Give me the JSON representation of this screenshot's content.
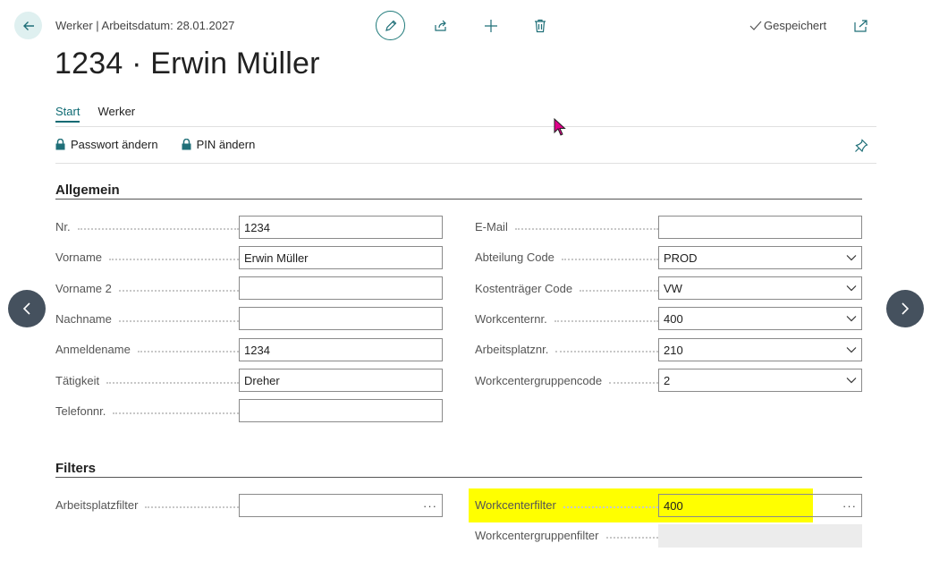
{
  "header": {
    "context": "Werker | Arbeitsdatum: 28.01.2027",
    "title": "1234 · Erwin Müller",
    "saved_label": "Gespeichert"
  },
  "tabs": [
    {
      "label": "Start",
      "active": true
    },
    {
      "label": "Werker",
      "active": false
    }
  ],
  "actions": [
    {
      "label": "Passwort ändern",
      "icon": "lock-icon"
    },
    {
      "label": "PIN ändern",
      "icon": "lock-icon"
    }
  ],
  "sections": {
    "general": {
      "title": "Allgemein",
      "left": [
        {
          "label": "Nr.",
          "value": "1234"
        },
        {
          "label": "Vorname",
          "value": "Erwin Müller"
        },
        {
          "label": "Vorname 2",
          "value": ""
        },
        {
          "label": "Nachname",
          "value": ""
        },
        {
          "label": "Anmeldename",
          "value": "1234"
        },
        {
          "label": "Tätigkeit",
          "value": "Dreher"
        },
        {
          "label": "Telefonnr.",
          "value": ""
        }
      ],
      "right": [
        {
          "label": "E-Mail",
          "value": ""
        },
        {
          "label": "Abteilung Code",
          "value": "PROD"
        },
        {
          "label": "Kostenträger Code",
          "value": "VW"
        },
        {
          "label": "Workcenternr.",
          "value": "400"
        },
        {
          "label": "Arbeitsplatznr.",
          "value": "210"
        },
        {
          "label": "Workcentergruppencode",
          "value": "2"
        }
      ]
    },
    "filters": {
      "title": "Filters",
      "arbeitsplatzfilter": {
        "label": "Arbeitsplatzfilter",
        "value": ""
      },
      "workcenterfilter": {
        "label": "Workcenterfilter",
        "value": "400"
      },
      "workcentergruppenfilter": {
        "label": "Workcentergruppenfilter",
        "value": ""
      }
    }
  },
  "colors": {
    "accent": "#0f6b74",
    "highlight": "#ffff00",
    "nav_button": "#45515e"
  }
}
